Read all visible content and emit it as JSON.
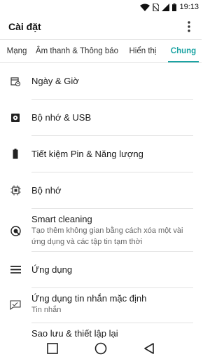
{
  "status": {
    "time": "19:13"
  },
  "appbar": {
    "title": "Cài đặt",
    "more_icon": "more-vert-icon"
  },
  "tabs": [
    {
      "label": "Mạng"
    },
    {
      "label": "Âm thanh & Thông báo"
    },
    {
      "label": "Hiển thị"
    },
    {
      "label": "Chung",
      "active": true
    }
  ],
  "items": [
    {
      "label": "Ngày & Giờ",
      "icon": "calendar-clock-icon"
    },
    {
      "label": "Bộ nhớ & USB",
      "icon": "storage-icon"
    },
    {
      "label": "Tiết kiệm Pin & Năng lượng",
      "icon": "battery-icon"
    },
    {
      "label": "Bộ nhớ",
      "icon": "memory-chip-icon"
    },
    {
      "label": "Smart cleaning",
      "sub": "Tạo thêm không gian bằng cách xóa một vài ứng dụng và các tập tin tạm thời",
      "icon": "smart-cleaning-icon"
    },
    {
      "label": "Ứng dụng",
      "icon": "apps-list-icon"
    },
    {
      "label": "Ứng dụng tin nhắn mặc định",
      "sub": "Tin nhắn",
      "icon": "message-icon"
    },
    {
      "label": "Sao lưu & thiết lập lại",
      "icon": "backup-icon"
    }
  ],
  "accent": "#1ba3a3"
}
